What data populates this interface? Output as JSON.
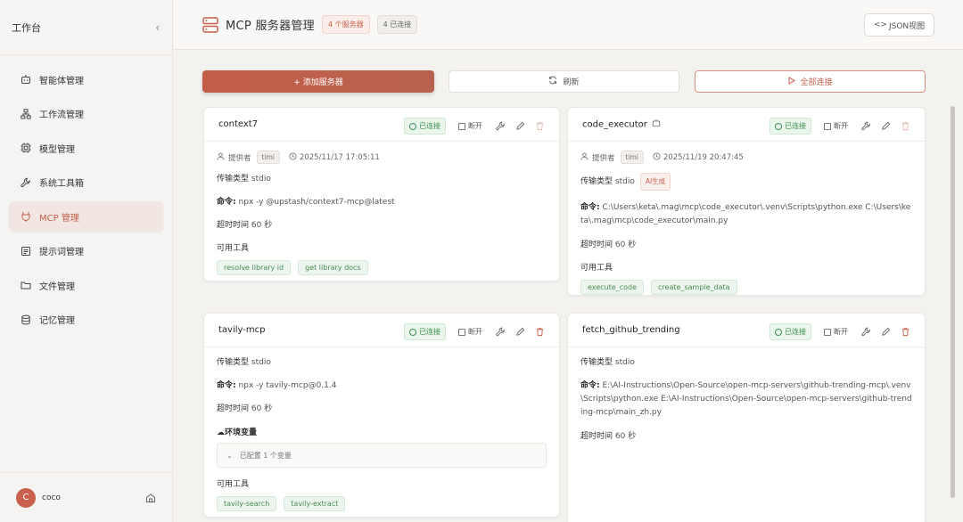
{
  "sidebar": {
    "title": "工作台",
    "collapse_glyph": "‹",
    "items": [
      {
        "label": "智能体管理",
        "icon": "robot-icon"
      },
      {
        "label": "工作流管理",
        "icon": "workflow-icon"
      },
      {
        "label": "模型管理",
        "icon": "chip-icon"
      },
      {
        "label": "系统工具箱",
        "icon": "wrench-icon"
      },
      {
        "label": "MCP 管理",
        "icon": "plug-icon",
        "active": true
      },
      {
        "label": "提示词管理",
        "icon": "document-icon"
      },
      {
        "label": "文件管理",
        "icon": "folder-icon"
      },
      {
        "label": "记忆管理",
        "icon": "database-icon"
      }
    ],
    "user": {
      "initial": "C",
      "name": "coco"
    }
  },
  "header": {
    "title": "MCP 服务器管理",
    "badge_servers": "4 个服务器",
    "badge_connected": "4 已连接",
    "json_button": "JSON视图"
  },
  "actions": {
    "add": "+ 添加服务器",
    "refresh": "刷新",
    "connect_all": "全部连接"
  },
  "labels": {
    "provider": "提供者",
    "transport": "传输类型",
    "command": "命令:",
    "timeout": "超时时间",
    "tools": "可用工具",
    "status": "已连接",
    "disconnect": "断开",
    "env": "环境变量"
  },
  "cards": [
    {
      "name": "context7",
      "provider": "timi",
      "time": "2025/11/17 17:05:11",
      "transport": "stdio",
      "command": "npx -y @upstash/context7-mcp@latest",
      "timeout": "60 秒",
      "tools": [
        "resolve library id",
        "get library docs"
      ]
    },
    {
      "name": "code_executor",
      "provider": "timi",
      "time": "2025/11/19 20:47:45",
      "provider_tag": "AI生成",
      "transport": "stdio",
      "command": "C:\\Users\\keta\\.mag\\mcp\\code_executor\\.venv\\Scripts\\python.exe C:\\Users\\keta\\.mag\\mcp\\code_executor\\main.py",
      "timeout": "60 秒",
      "tools": [
        "execute_code",
        "create_sample_data"
      ]
    },
    {
      "name": "tavily-mcp",
      "transport": "stdio",
      "command": "npx -y tavily-mcp@0.1.4",
      "timeout": "60 秒",
      "env_summary": "已配置 1 个变量",
      "tools": [
        "tavily-search",
        "tavily-extract"
      ]
    },
    {
      "name": "fetch_github_trending",
      "transport": "stdio",
      "command": "E:\\AI-Instructions\\Open-Source\\open-mcp-servers\\github-trending-mcp\\.venv\\Scripts\\python.exe E:\\AI-Instructions\\Open-Source\\open-mcp-servers\\github-trending-mcp\\main_zh.py",
      "timeout": "60 秒"
    }
  ]
}
